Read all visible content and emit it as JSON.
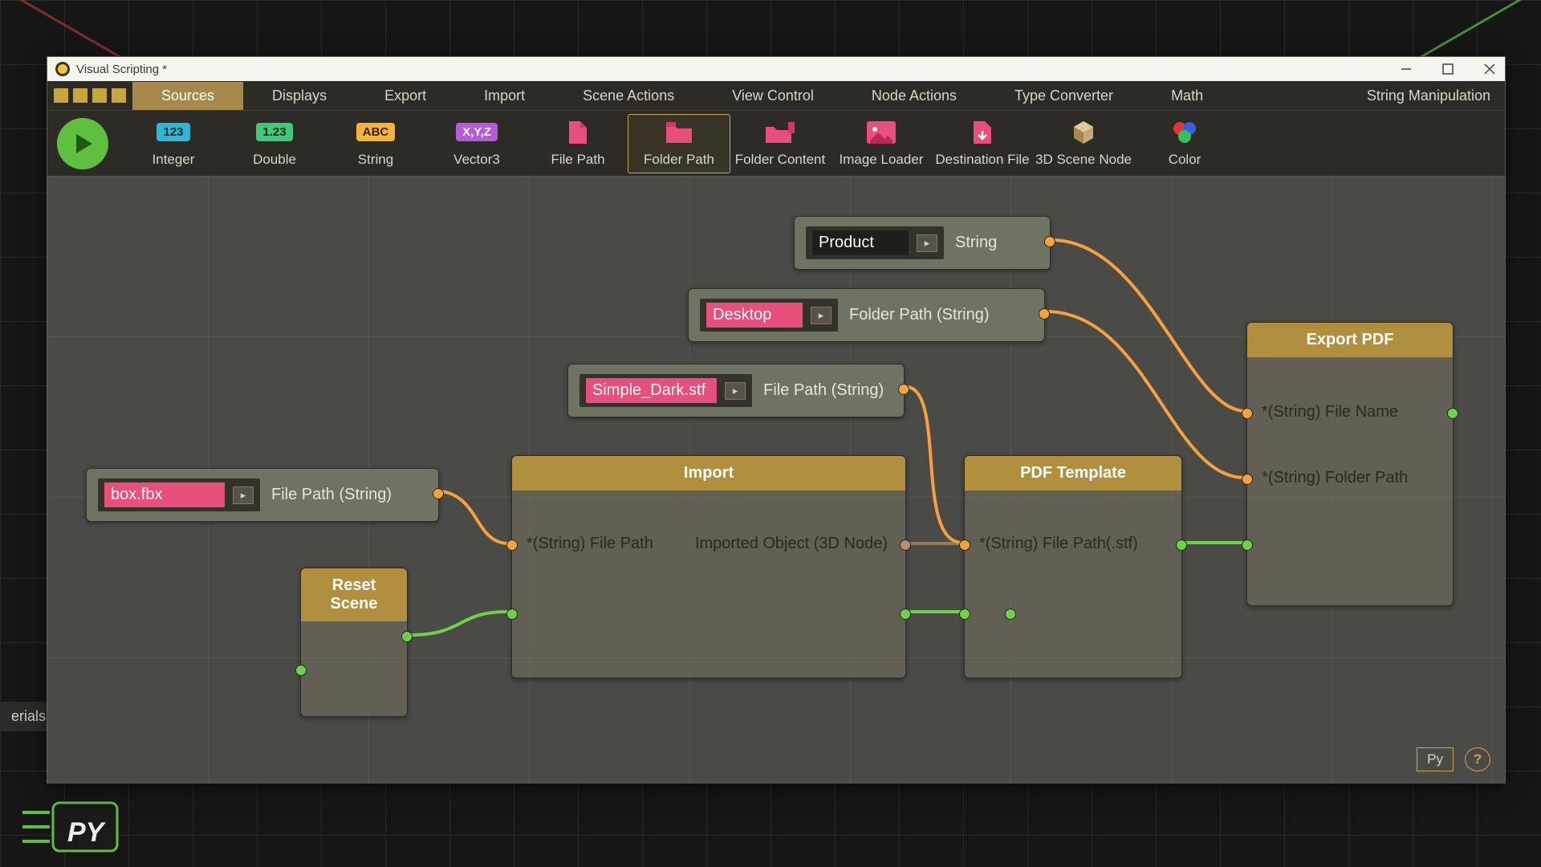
{
  "window": {
    "title": "Visual Scripting *"
  },
  "menubar": {
    "tabs": [
      "Sources",
      "Displays",
      "Export",
      "Import",
      "Scene Actions",
      "View Control",
      "Node Actions",
      "Type Converter",
      "Math",
      "String Manipulation"
    ],
    "active": 0
  },
  "ribbon": {
    "items": [
      {
        "id": "integer",
        "label": "Integer",
        "badge": "123",
        "bg": "#2fb7d6",
        "fg": "#0a2a33"
      },
      {
        "id": "double",
        "label": "Double",
        "badge": "1.23",
        "bg": "#3ec97a",
        "fg": "#0a2a15"
      },
      {
        "id": "string",
        "label": "String",
        "badge": "ABC",
        "bg": "#f5b23c",
        "fg": "#3a2400"
      },
      {
        "id": "vector3",
        "label": "Vector3",
        "badge": "X,Y,Z",
        "bg": "#b55bdc",
        "fg": "#fff"
      },
      {
        "id": "filepath",
        "label": "File Path"
      },
      {
        "id": "folderpath",
        "label": "Folder Path",
        "active": true
      },
      {
        "id": "foldercontent",
        "label": "Folder Content"
      },
      {
        "id": "imageloader",
        "label": "Image Loader"
      },
      {
        "id": "destfile",
        "label": "Destination File"
      },
      {
        "id": "scenenode",
        "label": "3D Scene Node"
      },
      {
        "id": "color",
        "label": "Color"
      }
    ]
  },
  "nodes": {
    "product": {
      "value": "Product",
      "label": "String"
    },
    "desktop": {
      "value": "Desktop",
      "label": "Folder Path (String)"
    },
    "simple_dark": {
      "value": "Simple_Dark.stf",
      "label": "File Path (String)"
    },
    "boxfbx": {
      "value": "box.fbx",
      "label": "File Path (String)"
    },
    "reset": {
      "title": "Reset Scene"
    },
    "import": {
      "title": "Import",
      "in": "*(String) File Path",
      "out": "Imported Object (3D Node)"
    },
    "pdf_template": {
      "title": "PDF Template",
      "in": "*(String) File Path(.stf)"
    },
    "export_pdf": {
      "title": "Export PDF",
      "in1": "*(String) File Name",
      "in2": "*(String) Folder Path"
    }
  },
  "side_tab": "erials",
  "footer": {
    "py": "Py",
    "help": "?"
  }
}
